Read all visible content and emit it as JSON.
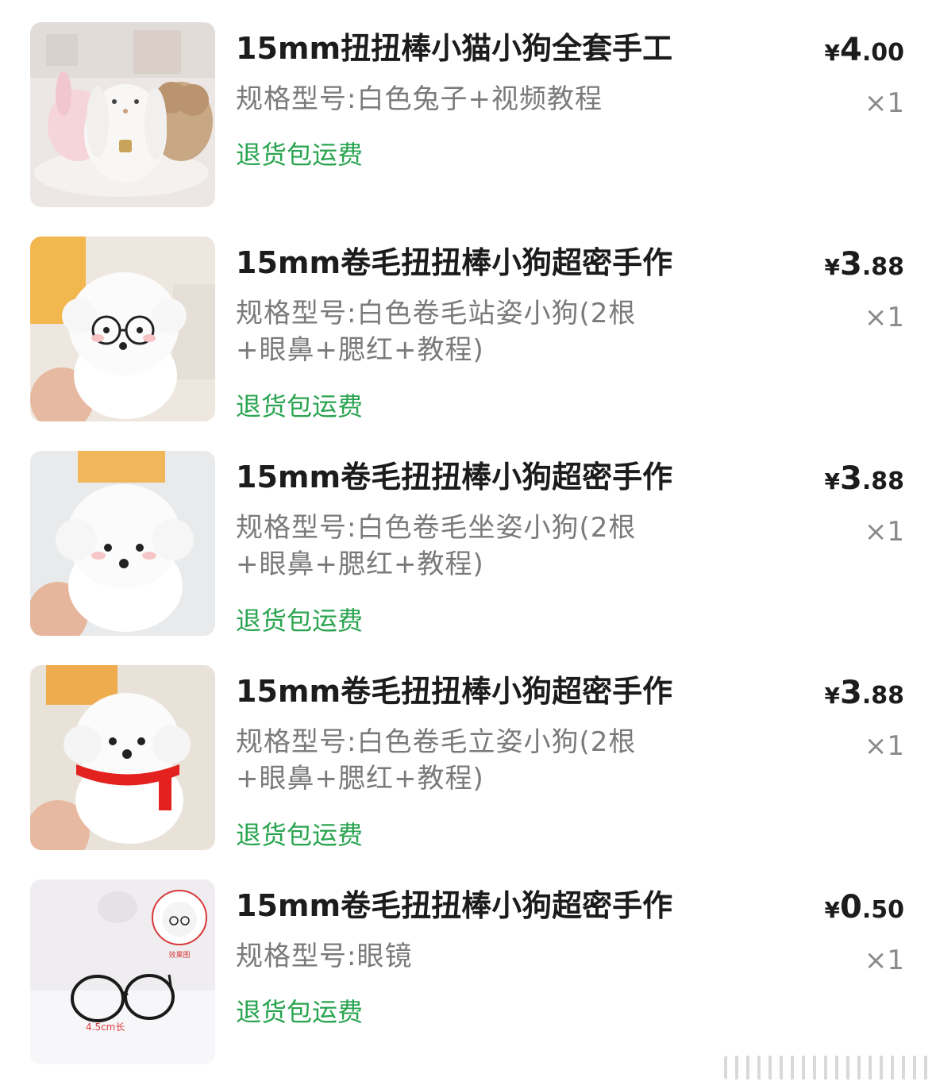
{
  "items": [
    {
      "title": "15mm扭扭棒小猫小狗全套手工",
      "spec_line1": "规格型号:白色兔子+视频教程",
      "spec_line2": "",
      "tag": "退货包运费",
      "currency": "¥",
      "price_int": "4",
      "price_dec": ".00",
      "qty": "×1",
      "image": "bunny-and-poodle-plush-photo"
    },
    {
      "title": "15mm卷毛扭扭棒小狗超密手作",
      "spec_line1": "规格型号:白色卷毛站姿小狗(2根",
      "spec_line2": "+眼鼻+腮红+教程)",
      "tag": "退货包运费",
      "currency": "¥",
      "price_int": "3",
      "price_dec": ".88",
      "qty": "×1",
      "image": "white-dog-with-glasses-photo"
    },
    {
      "title": "15mm卷毛扭扭棒小狗超密手作",
      "spec_line1": "规格型号:白色卷毛坐姿小狗(2根",
      "spec_line2": "+眼鼻+腮红+教程)",
      "tag": "退货包运费",
      "currency": "¥",
      "price_int": "3",
      "price_dec": ".88",
      "qty": "×1",
      "image": "white-sitting-dog-photo"
    },
    {
      "title": "15mm卷毛扭扭棒小狗超密手作",
      "spec_line1": "规格型号:白色卷毛立姿小狗(2根",
      "spec_line2": "+眼鼻+腮红+教程)",
      "tag": "退货包运费",
      "currency": "¥",
      "price_int": "3",
      "price_dec": ".88",
      "qty": "×1",
      "image": "white-dog-red-scarf-photo"
    },
    {
      "title": "15mm卷毛扭扭棒小狗超密手作",
      "spec_line1": "规格型号:眼镜",
      "spec_line2": "",
      "tag": "退货包运费",
      "currency": "¥",
      "price_int": "0",
      "price_dec": ".50",
      "qty": "×1",
      "image": "glasses-accessory-photo",
      "image_label": "4.5cm长",
      "image_badge": "效果图"
    }
  ],
  "colors": {
    "title": "#1c1c1c",
    "spec": "#7a7a7a",
    "tag_green": "#2aa450",
    "qty": "#8a8a8a"
  }
}
